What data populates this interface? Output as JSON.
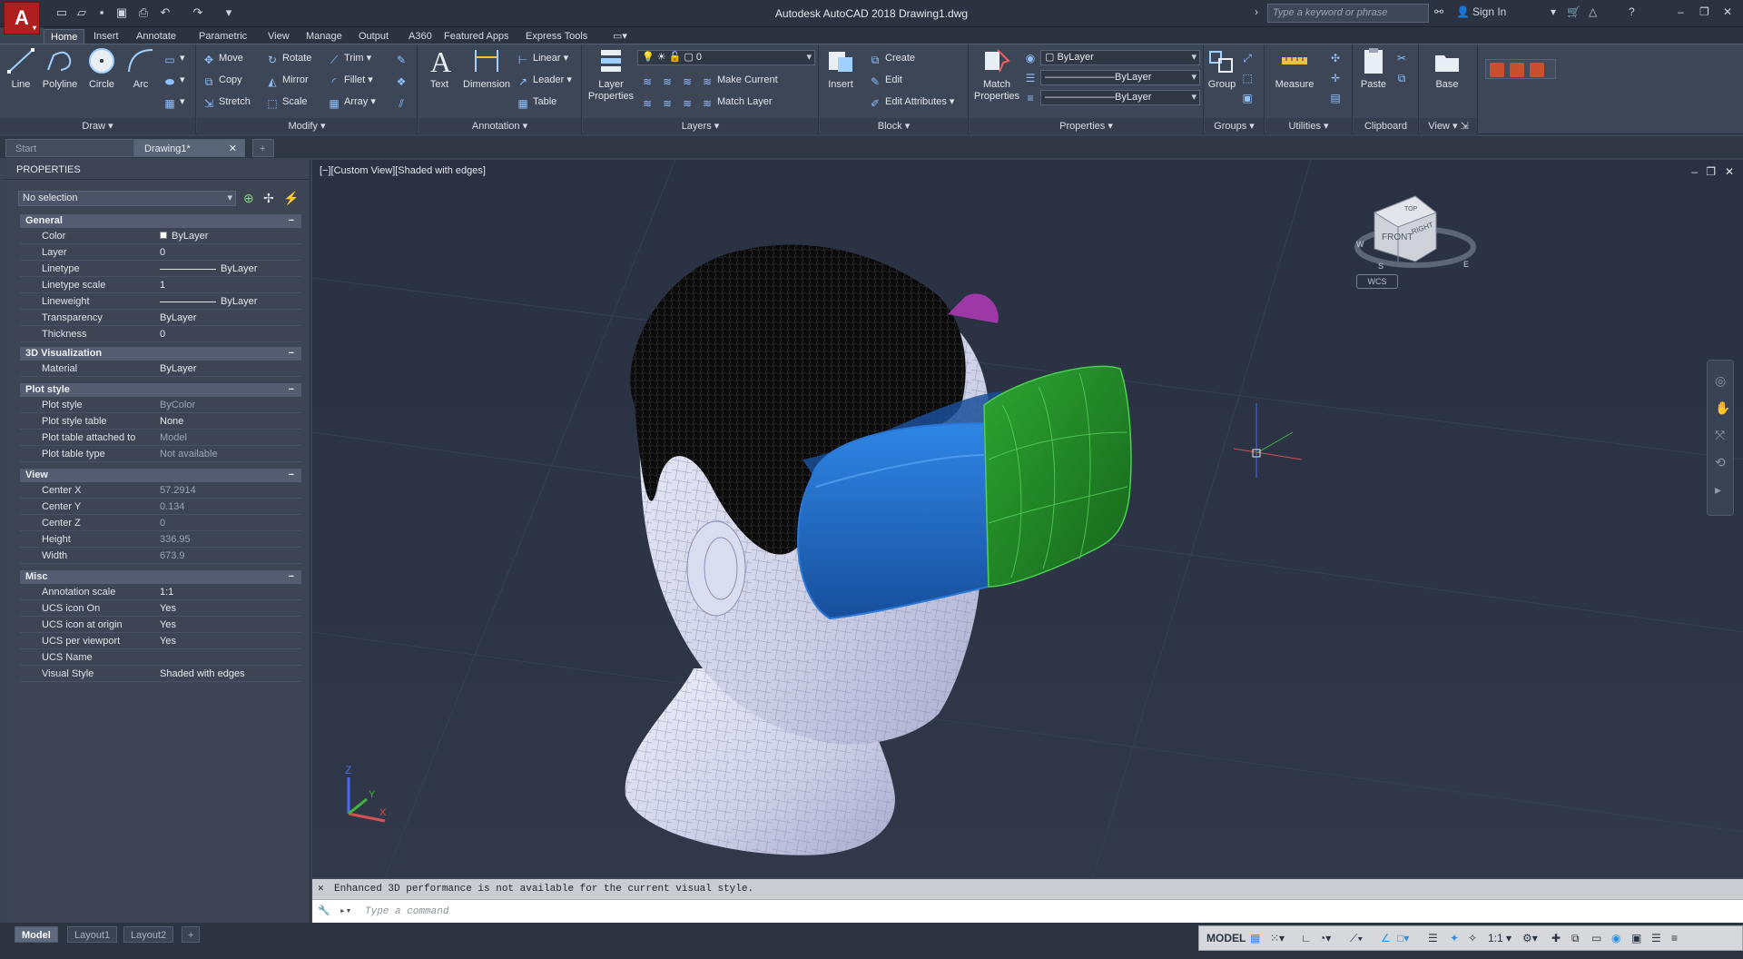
{
  "title_bar": {
    "app_title": "Autodesk AutoCAD 2018    Drawing1.dwg",
    "search_placeholder": "Type a keyword or phrase",
    "sign_in": "Sign In"
  },
  "menu_tabs": [
    "Home",
    "Insert",
    "Annotate",
    "Parametric",
    "View",
    "Manage",
    "Output",
    "A360",
    "Featured Apps",
    "Express Tools"
  ],
  "ribbon": {
    "draw": {
      "title": "Draw",
      "line": "Line",
      "polyline": "Polyline",
      "circle": "Circle",
      "arc": "Arc"
    },
    "modify": {
      "title": "Modify",
      "move": "Move",
      "rotate": "Rotate",
      "trim": "Trim",
      "copy": "Copy",
      "mirror": "Mirror",
      "fillet": "Fillet",
      "stretch": "Stretch",
      "scale": "Scale",
      "array": "Array"
    },
    "annotation": {
      "title": "Annotation",
      "text": "Text",
      "dimension": "Dimension",
      "linear": "Linear",
      "leader": "Leader",
      "table": "Table"
    },
    "layers": {
      "title": "Layers",
      "layer_properties_1": "Layer",
      "layer_properties_2": "Properties",
      "layer_combo": "0",
      "make_current": "Make Current",
      "match_layer": "Match Layer"
    },
    "block": {
      "title": "Block",
      "insert": "Insert",
      "create": "Create",
      "edit": "Edit",
      "edit_attributes": "Edit Attributes"
    },
    "properties": {
      "title": "Properties",
      "match_1": "Match",
      "match_2": "Properties",
      "color_combo": "ByLayer",
      "linetype_combo": "ByLayer",
      "lineweight_combo": "ByLayer"
    },
    "groups": {
      "title": "Groups",
      "group": "Group"
    },
    "utilities": {
      "title": "Utilities",
      "measure": "Measure"
    },
    "clipboard": {
      "title": "Clipboard",
      "paste": "Paste"
    },
    "view": {
      "title": "View",
      "base": "Base"
    }
  },
  "file_tabs": [
    "Start",
    "Drawing1*"
  ],
  "properties_palette": {
    "header": "PROPERTIES",
    "selection": "No selection",
    "general": {
      "title": "General",
      "rows": [
        {
          "k": "Color",
          "v": "ByLayer"
        },
        {
          "k": "Layer",
          "v": "0"
        },
        {
          "k": "Linetype",
          "v": "ByLayer"
        },
        {
          "k": "Linetype scale",
          "v": "1"
        },
        {
          "k": "Lineweight",
          "v": "ByLayer"
        },
        {
          "k": "Transparency",
          "v": "ByLayer"
        },
        {
          "k": "Thickness",
          "v": "0"
        }
      ]
    },
    "visualization": {
      "title": "3D Visualization",
      "rows": [
        {
          "k": "Material",
          "v": "ByLayer"
        }
      ]
    },
    "plot_style": {
      "title": "Plot style",
      "rows": [
        {
          "k": "Plot style",
          "v": "ByColor"
        },
        {
          "k": "Plot style table",
          "v": "None"
        },
        {
          "k": "Plot table attached to",
          "v": "Model"
        },
        {
          "k": "Plot table type",
          "v": "Not available"
        }
      ]
    },
    "view": {
      "title": "View",
      "rows": [
        {
          "k": "Center X",
          "v": "57.2914"
        },
        {
          "k": "Center Y",
          "v": "0.134"
        },
        {
          "k": "Center Z",
          "v": "0"
        },
        {
          "k": "Height",
          "v": "336.95"
        },
        {
          "k": "Width",
          "v": "673.9"
        }
      ]
    },
    "misc": {
      "title": "Misc",
      "rows": [
        {
          "k": "Annotation scale",
          "v": "1:1"
        },
        {
          "k": "UCS icon On",
          "v": "Yes"
        },
        {
          "k": "UCS icon at origin",
          "v": "Yes"
        },
        {
          "k": "UCS per viewport",
          "v": "Yes"
        },
        {
          "k": "UCS Name",
          "v": ""
        },
        {
          "k": "Visual Style",
          "v": "Shaded with edges"
        }
      ]
    }
  },
  "viewport": {
    "label": "[−][Custom View][Shaded with edges]",
    "viewcube_front": "FRONT",
    "viewcube_right": "RIGHT",
    "viewcube_top": "TOP",
    "wcs": "WCS",
    "compass_w": "W",
    "compass_s": "S",
    "compass_e": "E"
  },
  "command": {
    "history": "Enhanced 3D performance is not available for the current visual style.",
    "placeholder": "Type a command"
  },
  "layout_tabs": [
    "Model",
    "Layout1",
    "Layout2"
  ],
  "status": {
    "model": "MODEL",
    "scale": "1:1"
  },
  "colors": {
    "accent": "#2f8fe8",
    "logo": "#b01f1f",
    "visor_blue": "#1f68c7",
    "visor_green": "#1f8a24",
    "hair": "#0b0b0b",
    "skin": "#d5d6ec"
  }
}
